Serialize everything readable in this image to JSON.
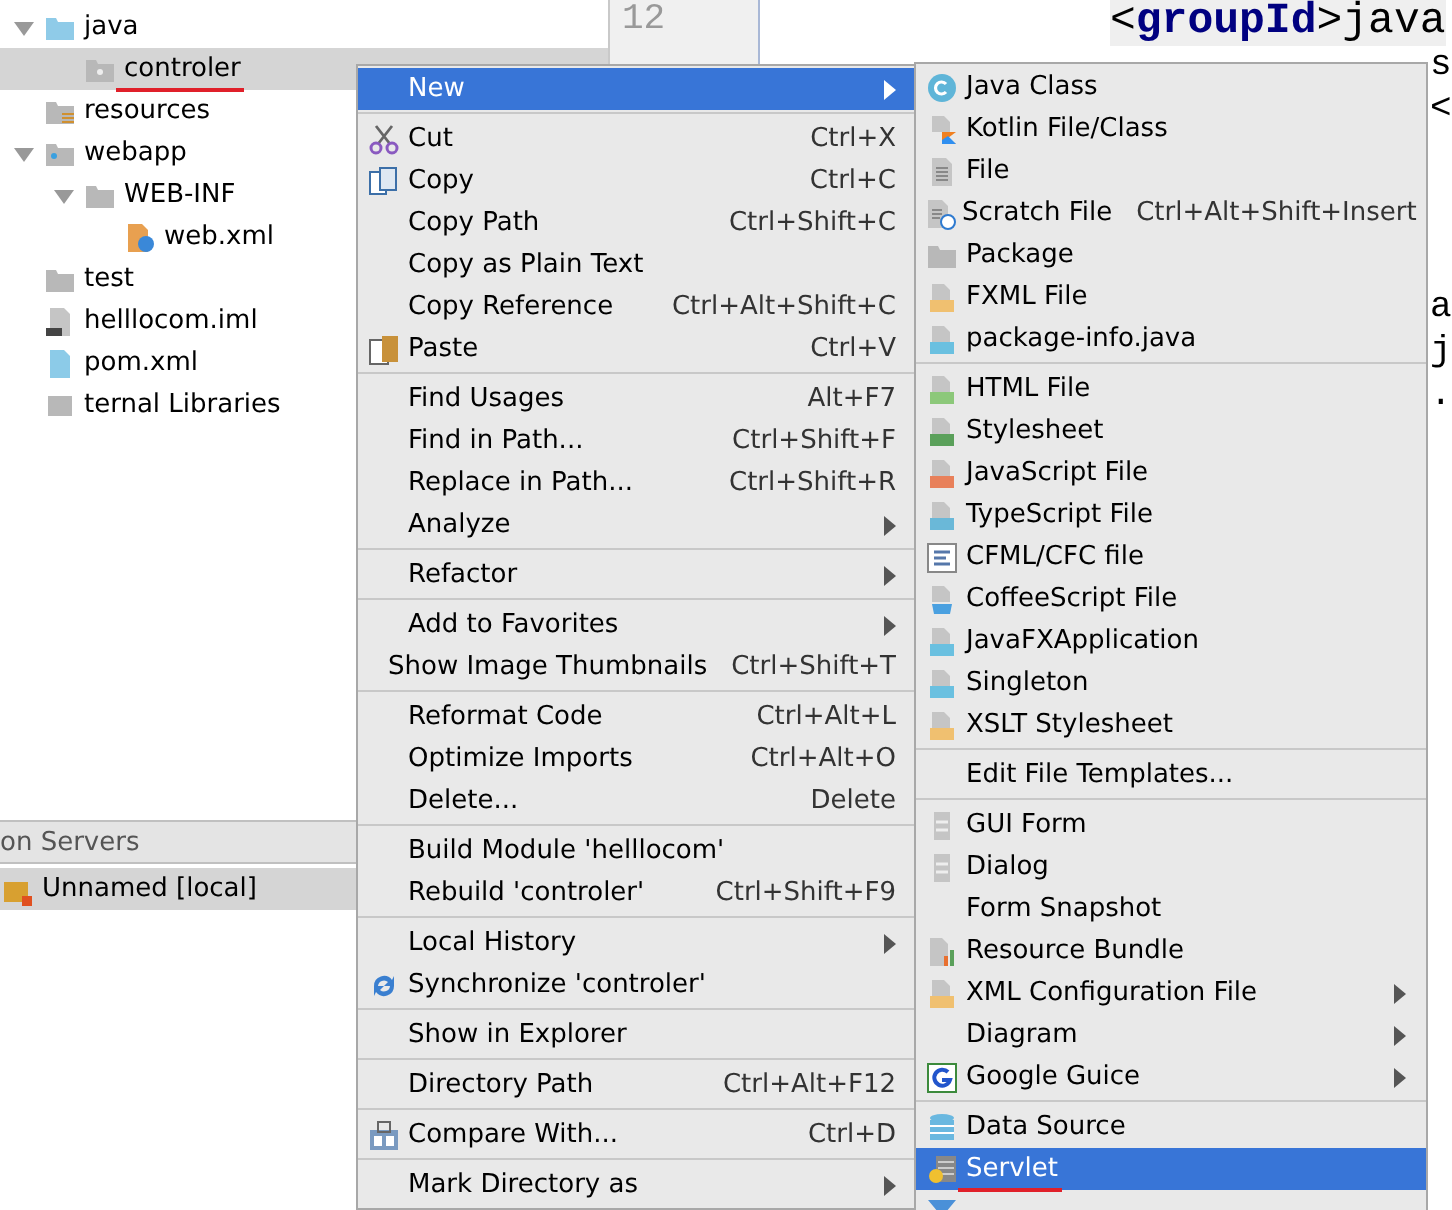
{
  "project_tree": [
    {
      "label": "java",
      "kind": "source",
      "expanded": true,
      "selected": false,
      "underlined": false,
      "children": [
        {
          "label": "controler",
          "kind": "package",
          "selected": true,
          "underlined": true
        }
      ]
    },
    {
      "label": "resources",
      "kind": "resources",
      "selected": false,
      "underlined": false
    },
    {
      "label": "webapp",
      "kind": "web",
      "expanded": true,
      "selected": false,
      "underlined": false,
      "children": [
        {
          "label": "WEB-INF",
          "kind": "folder",
          "expanded": true,
          "selected": false,
          "underlined": false,
          "children": [
            {
              "label": "web.xml",
              "kind": "xml",
              "selected": false,
              "underlined": false
            }
          ]
        }
      ]
    },
    {
      "label": "test",
      "kind": "folder",
      "selected": false,
      "underlined": false
    },
    {
      "label": "helllocom.iml",
      "kind": "iml",
      "selected": false,
      "underlined": false
    },
    {
      "label": "pom.xml",
      "kind": "maven",
      "selected": false,
      "underlined": false
    },
    {
      "label": "ternal Libraries",
      "kind": "library",
      "selected": false,
      "underlined": false
    }
  ],
  "servers_panel": {
    "title": "on Servers",
    "items": [
      {
        "label": "Unnamed [local]",
        "selected": true
      }
    ]
  },
  "editor": {
    "line_numbers": [
      "12"
    ],
    "code_blocks": [
      [
        {
          "text": "<**groupId**>java",
          "kind": "full"
        },
        {
          "text": "s",
          "kind": "clipped"
        },
        {
          "text": "<",
          "kind": "clipped"
        }
      ],
      [
        {
          "text": "a",
          "kind": "clipped"
        },
        {
          "text": "j",
          "kind": "clipped"
        },
        {
          "text": ".",
          "kind": "clipped"
        }
      ]
    ]
  },
  "context_menu": {
    "groups": [
      [
        {
          "label": "New",
          "selected": true,
          "has_submenu": true,
          "kind": "plain"
        }
      ],
      [
        {
          "label": "Cut",
          "shortcut": "Ctrl+X",
          "selected": false,
          "has_submenu": false,
          "kind": "cut"
        },
        {
          "label": "Copy",
          "shortcut": "Ctrl+C",
          "selected": false,
          "has_submenu": false,
          "kind": "copy"
        },
        {
          "label": "Copy Path",
          "shortcut": "Ctrl+Shift+C",
          "selected": false,
          "has_submenu": false,
          "kind": "plain"
        },
        {
          "label": "Copy as Plain Text",
          "selected": false,
          "has_submenu": false,
          "kind": "plain"
        },
        {
          "label": "Copy Reference",
          "shortcut": "Ctrl+Alt+Shift+C",
          "selected": false,
          "has_submenu": false,
          "kind": "plain"
        },
        {
          "label": "Paste",
          "shortcut": "Ctrl+V",
          "selected": false,
          "has_submenu": false,
          "kind": "paste"
        }
      ],
      [
        {
          "label": "Find Usages",
          "shortcut": "Alt+F7",
          "selected": false,
          "has_submenu": false,
          "kind": "plain"
        },
        {
          "label": "Find in Path...",
          "shortcut": "Ctrl+Shift+F",
          "selected": false,
          "has_submenu": false,
          "kind": "plain"
        },
        {
          "label": "Replace in Path...",
          "shortcut": "Ctrl+Shift+R",
          "selected": false,
          "has_submenu": false,
          "kind": "plain"
        },
        {
          "label": "Analyze",
          "selected": false,
          "has_submenu": true,
          "kind": "plain"
        }
      ],
      [
        {
          "label": "Refactor",
          "selected": false,
          "has_submenu": true,
          "kind": "plain"
        }
      ],
      [
        {
          "label": "Add to Favorites",
          "selected": false,
          "has_submenu": true,
          "kind": "plain"
        },
        {
          "label": "Show Image Thumbnails",
          "shortcut": "Ctrl+Shift+T",
          "selected": false,
          "has_submenu": false,
          "kind": "plain"
        }
      ],
      [
        {
          "label": "Reformat Code",
          "shortcut": "Ctrl+Alt+L",
          "selected": false,
          "has_submenu": false,
          "kind": "plain"
        },
        {
          "label": "Optimize Imports",
          "shortcut": "Ctrl+Alt+O",
          "selected": false,
          "has_submenu": false,
          "kind": "plain"
        },
        {
          "label": "Delete...",
          "shortcut": "Delete",
          "selected": false,
          "has_submenu": false,
          "kind": "plain"
        }
      ],
      [
        {
          "label": "Build Module 'helllocom'",
          "selected": false,
          "has_submenu": false,
          "kind": "plain"
        },
        {
          "label": "Rebuild 'controler'",
          "shortcut": "Ctrl+Shift+F9",
          "selected": false,
          "has_submenu": false,
          "kind": "plain"
        }
      ],
      [
        {
          "label": "Local History",
          "selected": false,
          "has_submenu": true,
          "kind": "plain"
        },
        {
          "label": "Synchronize 'controler'",
          "selected": false,
          "has_submenu": false,
          "kind": "sync"
        }
      ],
      [
        {
          "label": "Show in Explorer",
          "selected": false,
          "has_submenu": false,
          "kind": "plain"
        }
      ],
      [
        {
          "label": "Directory Path",
          "shortcut": "Ctrl+Alt+F12",
          "selected": false,
          "has_submenu": false,
          "kind": "plain"
        }
      ],
      [
        {
          "label": "Compare With...",
          "shortcut": "Ctrl+D",
          "selected": false,
          "has_submenu": false,
          "kind": "compare"
        }
      ],
      [
        {
          "label": "Mark Directory as",
          "selected": false,
          "has_submenu": true,
          "kind": "plain"
        }
      ]
    ]
  },
  "new_submenu": {
    "groups": [
      [
        {
          "label": "Java Class",
          "selected": false,
          "has_submenu": false,
          "underlined": false,
          "kind": "class"
        },
        {
          "label": "Kotlin File/Class",
          "selected": false,
          "has_submenu": false,
          "underlined": false,
          "kind": "kotlin"
        },
        {
          "label": "File",
          "selected": false,
          "has_submenu": false,
          "underlined": false,
          "kind": "file"
        },
        {
          "label": "Scratch File",
          "shortcut": "Ctrl+Alt+Shift+Insert",
          "selected": false,
          "has_submenu": false,
          "underlined": false,
          "kind": "scratch"
        },
        {
          "label": "Package",
          "selected": false,
          "has_submenu": false,
          "underlined": false,
          "kind": "package"
        },
        {
          "label": "FXML File",
          "selected": false,
          "has_submenu": false,
          "underlined": false,
          "kind": "markup"
        },
        {
          "label": "package-info.java",
          "selected": false,
          "has_submenu": false,
          "underlined": false,
          "kind": "javafile"
        }
      ],
      [
        {
          "label": "HTML File",
          "selected": false,
          "has_submenu": false,
          "underlined": false,
          "kind": "html"
        },
        {
          "label": "Stylesheet",
          "selected": false,
          "has_submenu": false,
          "underlined": false,
          "kind": "css"
        },
        {
          "label": "JavaScript File",
          "selected": false,
          "has_submenu": false,
          "underlined": false,
          "kind": "js"
        },
        {
          "label": "TypeScript File",
          "selected": false,
          "has_submenu": false,
          "underlined": false,
          "kind": "ts"
        },
        {
          "label": "CFML/CFC file",
          "selected": false,
          "has_submenu": false,
          "underlined": false,
          "kind": "cfml"
        },
        {
          "label": "CoffeeScript File",
          "selected": false,
          "has_submenu": false,
          "underlined": false,
          "kind": "coffee"
        },
        {
          "label": "JavaFXApplication",
          "selected": false,
          "has_submenu": false,
          "underlined": false,
          "kind": "javafile"
        },
        {
          "label": "Singleton",
          "selected": false,
          "has_submenu": false,
          "underlined": false,
          "kind": "javafile"
        },
        {
          "label": "XSLT Stylesheet",
          "selected": false,
          "has_submenu": false,
          "underlined": false,
          "kind": "markup"
        }
      ],
      [
        {
          "label": "Edit File Templates...",
          "selected": false,
          "has_submenu": false,
          "underlined": false,
          "kind": "plain"
        }
      ],
      [
        {
          "label": "GUI Form",
          "selected": false,
          "has_submenu": false,
          "underlined": false,
          "kind": "form"
        },
        {
          "label": "Dialog",
          "selected": false,
          "has_submenu": false,
          "underlined": false,
          "kind": "form"
        },
        {
          "label": "Form Snapshot",
          "selected": false,
          "has_submenu": false,
          "underlined": false,
          "kind": "plain"
        },
        {
          "label": "Resource Bundle",
          "selected": false,
          "has_submenu": false,
          "underlined": false,
          "kind": "bundle"
        },
        {
          "label": "XML Configuration File",
          "selected": false,
          "has_submenu": true,
          "underlined": false,
          "kind": "markup"
        },
        {
          "label": "Diagram",
          "selected": false,
          "has_submenu": true,
          "underlined": false,
          "kind": "plain"
        },
        {
          "label": "Google Guice",
          "selected": false,
          "has_submenu": true,
          "underlined": false,
          "kind": "guice"
        }
      ],
      [
        {
          "label": "Data Source",
          "selected": false,
          "has_submenu": false,
          "underlined": false,
          "kind": "database"
        },
        {
          "label": "Servlet",
          "selected": true,
          "has_submenu": false,
          "underlined": true,
          "kind": "servlet"
        },
        {
          "selected": false,
          "has_submenu": false,
          "underlined": false,
          "kind": "filter"
        }
      ]
    ]
  }
}
